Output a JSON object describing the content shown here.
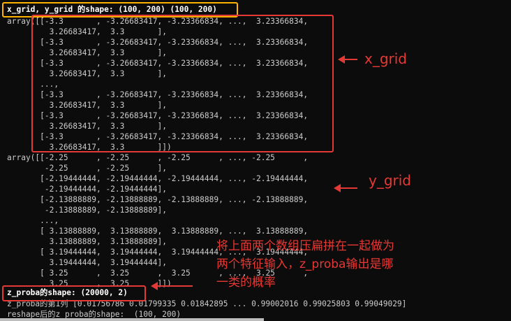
{
  "console": {
    "lines": [
      "x_grid, y_grid 的shape: (100, 200) (100, 200)",
      "array([[-3.3       , -3.26683417, -3.23366834, ...,  3.23366834,",
      "         3.26683417,  3.3       ],",
      "       [-3.3       , -3.26683417, -3.23366834, ...,  3.23366834,",
      "         3.26683417,  3.3       ],",
      "       [-3.3       , -3.26683417, -3.23366834, ...,  3.23366834,",
      "         3.26683417,  3.3       ],",
      "       ...,",
      "       [-3.3       , -3.26683417, -3.23366834, ...,  3.23366834,",
      "         3.26683417,  3.3       ],",
      "       [-3.3       , -3.26683417, -3.23366834, ...,  3.23366834,",
      "         3.26683417,  3.3       ],",
      "       [-3.3       , -3.26683417, -3.23366834, ...,  3.23366834,",
      "         3.26683417,  3.3       ]])",
      "array([[-2.25      , -2.25      , -2.25      , ..., -2.25      ,",
      "        -2.25      , -2.25      ],",
      "       [-2.19444444, -2.19444444, -2.19444444, ..., -2.19444444,",
      "        -2.19444444, -2.19444444],",
      "       [-2.13888889, -2.13888889, -2.13888889, ..., -2.13888889,",
      "        -2.13888889, -2.13888889],",
      "       ...,",
      "       [ 3.13888889,  3.13888889,  3.13888889, ...,  3.13888889,",
      "         3.13888889,  3.13888889],",
      "       [ 3.19444444,  3.19444444,  3.19444444, ...,  3.19444444,",
      "         3.19444444,  3.19444444],",
      "       [ 3.25      ,  3.25      ,  3.25      , ...,  3.25      ,",
      "         3.25      ,  3.25      ]])",
      "z_proba的shape: (20000, 2)",
      "z_proba的第1列 [0.01756786 0.01799335 0.01842895 ... 0.99002016 0.99025803 0.99049029]",
      "reshape后的z_proba的shape:  (100, 200)"
    ]
  },
  "annotations": {
    "x_grid_label": "x_grid",
    "y_grid_label": "y_grid",
    "note_line1": "将上面两个数组压扁拼在一起做为",
    "note_line2": "两个特征输入，z_proba输出是哪",
    "note_line3": "一类的概率"
  },
  "colors": {
    "background": "#0c0c0c",
    "text": "#cccccc",
    "annotation_red": "#e53935",
    "highlight_yellow": "#ffb300"
  }
}
